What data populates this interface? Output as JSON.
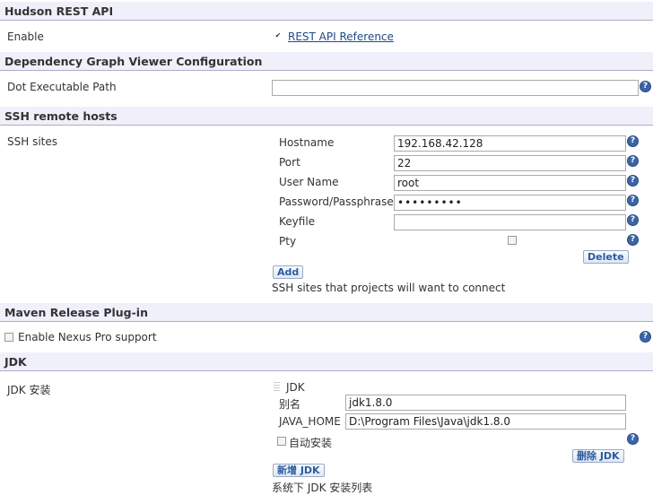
{
  "hudson": {
    "title": "Hudson REST API",
    "enable_label": "Enable",
    "enable_checked": true,
    "link_label": "REST API Reference"
  },
  "dependency": {
    "title": "Dependency Graph Viewer Configuration",
    "dot_label": "Dot Executable Path",
    "dot_value": ""
  },
  "ssh": {
    "title": "SSH remote hosts",
    "sites_label": "SSH sites",
    "hostname_label": "Hostname",
    "hostname_value": "192.168.42.128",
    "port_label": "Port",
    "port_value": "22",
    "username_label": "User Name",
    "username_value": "root",
    "password_label": "Password/Passphrase",
    "password_value": "•••••••••",
    "keyfile_label": "Keyfile",
    "keyfile_value": "",
    "pty_label": "Pty",
    "pty_checked": false,
    "delete_label": "Delete",
    "add_label": "Add",
    "desc": "SSH sites that projects will want to connect"
  },
  "maven": {
    "title": "Maven Release Plug-in",
    "nexus_label": "Enable Nexus Pro support",
    "nexus_checked": false
  },
  "jdk": {
    "title": "JDK",
    "install_label": "JDK 安装",
    "item_header": "JDK",
    "name_label": "别名",
    "name_value": "jdk1.8.0",
    "home_label": "JAVA_HOME",
    "home_value": "D:\\Program Files\\Java\\jdk1.8.0",
    "auto_label": "自动安装",
    "auto_checked": false,
    "delete_label": "删除 JDK",
    "add_label": "新增 JDK",
    "desc": "系统下 JDK 安装列表"
  },
  "help_glyph": "?",
  "check_glyph": "✔"
}
